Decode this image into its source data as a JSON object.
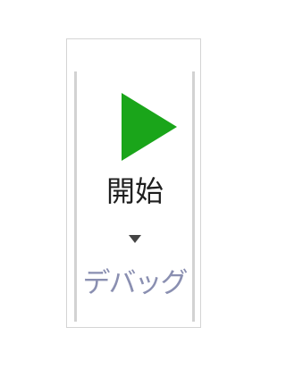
{
  "ribbon_group": {
    "start_button": {
      "label": "開始",
      "icon": "play-icon",
      "icon_color": "#1aa51a",
      "has_dropdown": true,
      "dropdown_icon": "dropdown-arrow-icon"
    },
    "group_label": "デバッグ"
  }
}
